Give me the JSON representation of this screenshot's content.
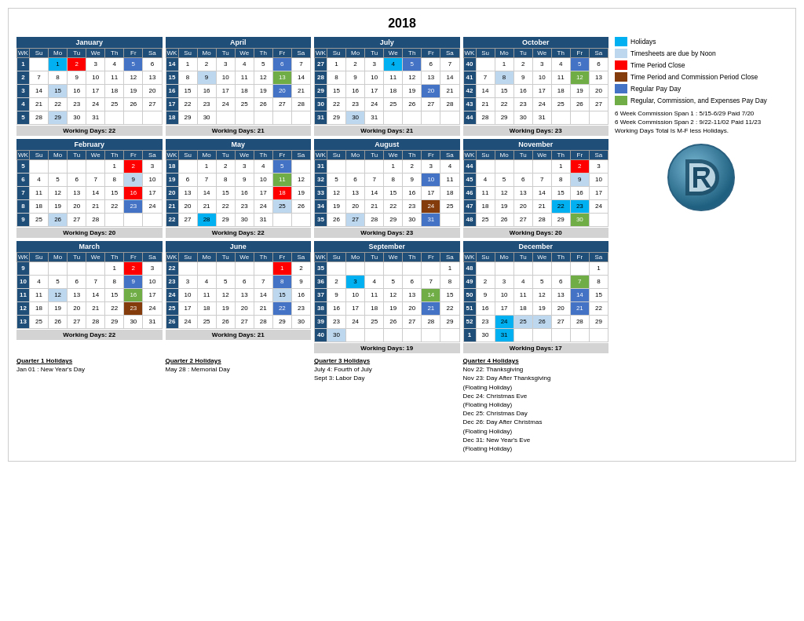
{
  "title": "2018",
  "legend": {
    "items": [
      {
        "color": "#00b0f0",
        "label": "Holidays"
      },
      {
        "color": "#bdd7ee",
        "label": "Timesheets are due by Noon"
      },
      {
        "color": "#ff0000",
        "label": "Time Period Close"
      },
      {
        "color": "#843c0c",
        "label": "Time Period and Commission Period Close"
      },
      {
        "color": "#4472c4",
        "label": "Regular Pay Day"
      },
      {
        "color": "#70ad47",
        "label": "Regular, Commission, and Expenses Pay Day"
      }
    ]
  },
  "notes": [
    "6 Week Commission Span 1 : 5/15-6/29 Paid 7/20",
    "6 Week Commission Span 2 : 9/22-11/02 Paid 11/23",
    "Working Days Total Is M-F less Holidays."
  ],
  "quarters": [
    {
      "months": [
        {
          "name": "January",
          "workingDays": "Working Days: 22",
          "weeks": [
            {
              "wk": "WK",
              "days": [
                "Su",
                "Mo",
                "Tu",
                "We",
                "Th",
                "Fr",
                "Sa"
              ]
            },
            {
              "wk": "1",
              "days": [
                "",
                "1",
                "2",
                "3",
                "4",
                "5",
                "6"
              ],
              "colors": [
                "",
                "",
                "red",
                "",
                "",
                "blue",
                ""
              ]
            },
            {
              "wk": "2",
              "days": [
                "7",
                "8",
                "9",
                "10",
                "11",
                "12",
                "13"
              ],
              "colors": [
                "",
                "",
                "",
                "",
                "",
                "",
                ""
              ]
            },
            {
              "wk": "3",
              "days": [
                "14",
                "15",
                "16",
                "17",
                "18",
                "19",
                "20"
              ],
              "colors": [
                "",
                "lightblue",
                "",
                "",
                "",
                "",
                ""
              ]
            },
            {
              "wk": "4",
              "days": [
                "21",
                "22",
                "23",
                "24",
                "25",
                "26",
                "27"
              ],
              "colors": [
                "",
                "",
                "",
                "",
                "",
                "",
                ""
              ]
            },
            {
              "wk": "5",
              "days": [
                "28",
                "29",
                "30",
                "31",
                "",
                "",
                ""
              ],
              "colors": [
                "",
                "lightblue",
                "",
                "",
                ""
              ]
            }
          ]
        },
        {
          "name": "April",
          "workingDays": "Working Days: 21",
          "weeks": [
            {
              "wk": "WK",
              "days": [
                "Su",
                "Mo",
                "Tu",
                "We",
                "Th",
                "Fr",
                "Sa"
              ]
            },
            {
              "wk": "14",
              "days": [
                "1",
                "2",
                "3",
                "4",
                "5",
                "6",
                "7"
              ],
              "colors": [
                "",
                "",
                "",
                "",
                "",
                "blue",
                ""
              ]
            },
            {
              "wk": "15",
              "days": [
                "8",
                "9",
                "10",
                "11",
                "12",
                "13",
                "14"
              ],
              "colors": [
                "",
                "lightblue",
                "",
                "",
                "",
                "green",
                ""
              ]
            },
            {
              "wk": "16",
              "days": [
                "15",
                "16",
                "17",
                "18",
                "19",
                "20",
                "21"
              ],
              "colors": [
                "",
                "",
                "",
                "",
                "",
                "",
                ""
              ]
            },
            {
              "wk": "17",
              "days": [
                "22",
                "23",
                "24",
                "25",
                "26",
                "27",
                "28"
              ],
              "colors": [
                "",
                "",
                "",
                "",
                "",
                "",
                ""
              ]
            },
            {
              "wk": "18",
              "days": [
                "29",
                "30",
                "",
                "",
                "",
                "",
                ""
              ],
              "colors": [
                "",
                ""
              ]
            }
          ]
        },
        {
          "name": "July",
          "workingDays": "Working Days: 21",
          "weeks": [
            {
              "wk": "WK",
              "days": [
                "Su",
                "Mo",
                "Tu",
                "We",
                "Th",
                "Fr",
                "Sa"
              ]
            },
            {
              "wk": "27",
              "days": [
                "1",
                "2",
                "3",
                "4",
                "5",
                "6",
                "7"
              ],
              "colors": [
                "",
                "",
                "",
                "cyan",
                "blue",
                "",
                ""
              ]
            },
            {
              "wk": "28",
              "days": [
                "8",
                "9",
                "10",
                "11",
                "12",
                "13",
                "14"
              ],
              "colors": [
                "",
                "",
                "",
                "",
                "",
                "",
                ""
              ]
            },
            {
              "wk": "29",
              "days": [
                "15",
                "16",
                "17",
                "18",
                "19",
                "20",
                "21"
              ],
              "colors": [
                "",
                "",
                "",
                "",
                "",
                "blue",
                ""
              ]
            },
            {
              "wk": "30",
              "days": [
                "22",
                "23",
                "24",
                "25",
                "26",
                "27",
                "28"
              ],
              "colors": [
                "",
                "",
                "",
                "",
                "",
                "",
                ""
              ]
            },
            {
              "wk": "31",
              "days": [
                "29",
                "30",
                "31",
                "",
                "",
                "",
                ""
              ],
              "colors": [
                "",
                "lightblue",
                ""
              ]
            }
          ]
        },
        {
          "name": "October",
          "workingDays": "Working Days: 23",
          "weeks": [
            {
              "wk": "WK",
              "days": [
                "Su",
                "Mo",
                "Tu",
                "We",
                "Th",
                "Fr",
                "Sa"
              ]
            },
            {
              "wk": "40",
              "days": [
                "",
                "1",
                "2",
                "3",
                "4",
                "5",
                "6"
              ],
              "colors": [
                "",
                "",
                "",
                "",
                "",
                "blue",
                ""
              ]
            },
            {
              "wk": "41",
              "days": [
                "7",
                "8",
                "9",
                "10",
                "11",
                "12",
                "13"
              ],
              "colors": [
                "",
                "lightblue",
                "",
                "",
                "",
                "green",
                ""
              ]
            },
            {
              "wk": "42",
              "days": [
                "14",
                "15",
                "16",
                "17",
                "18",
                "19",
                "20"
              ],
              "colors": [
                "",
                "",
                "",
                "",
                "",
                "",
                ""
              ]
            },
            {
              "wk": "43",
              "days": [
                "21",
                "22",
                "23",
                "24",
                "25",
                "26",
                "27"
              ],
              "colors": [
                "",
                "",
                "",
                "",
                "",
                "",
                ""
              ]
            },
            {
              "wk": "44",
              "days": [
                "28",
                "29",
                "30",
                "31",
                "",
                "",
                ""
              ],
              "colors": [
                "",
                "",
                ""
              ]
            }
          ]
        }
      ],
      "holidays": [
        {
          "quarter": "Quarter 1 Holidays",
          "items": [
            "Jan 01 : New Year's Day"
          ]
        },
        {
          "quarter": "Quarter 2 Holidays",
          "items": [
            "May 28 : Memorial Day"
          ]
        },
        {
          "quarter": "Quarter 3 Holidays",
          "items": [
            "July 4: Fourth of July",
            "Sept 3: Labor Day"
          ]
        },
        {
          "quarter": "Quarter 4 Holidays",
          "items": [
            "Nov 22: Thanksgiving",
            "Nov 23: Day After Thanksgiving",
            "(Floating Holiday)",
            "Dec 24: Christmas Eve",
            "(Floating Holiday)",
            "Dec 25: Christmas Day",
            "Dec 26: Day After Christmas",
            "(Floating Holiday)",
            "Dec 31: New Year's Eve",
            "(Floating Holiday)"
          ]
        }
      ]
    }
  ]
}
